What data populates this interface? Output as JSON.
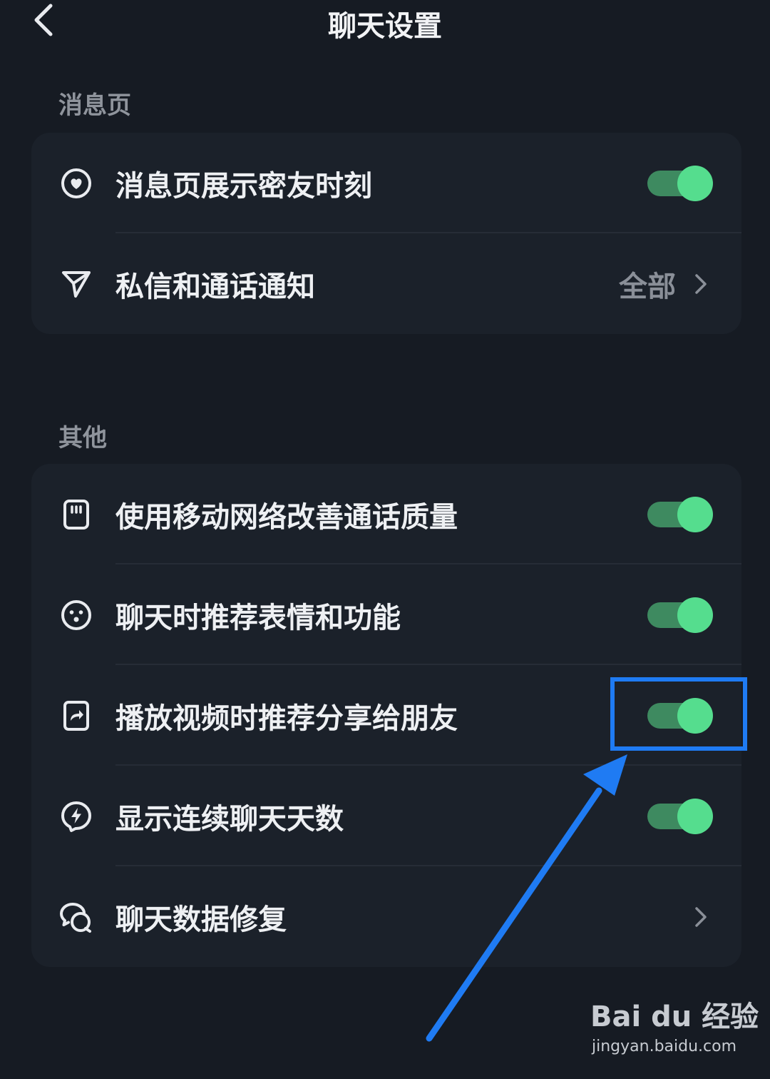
{
  "header": {
    "title": "聊天设置"
  },
  "sections": [
    {
      "title": "消息页",
      "items": [
        {
          "label": "消息页展示密友时刻",
          "control": "toggle",
          "on": true,
          "icon": "heart-circle-icon"
        },
        {
          "label": "私信和通话通知",
          "control": "value",
          "value": "全部",
          "icon": "send-icon"
        }
      ]
    },
    {
      "title": "其他",
      "items": [
        {
          "label": "使用移动网络改善通话质量",
          "control": "toggle",
          "on": true,
          "icon": "sim-card-icon"
        },
        {
          "label": "聊天时推荐表情和功能",
          "control": "toggle",
          "on": true,
          "icon": "smiley-icon"
        },
        {
          "label": "播放视频时推荐分享给朋友",
          "control": "toggle",
          "on": true,
          "icon": "share-icon"
        },
        {
          "label": "显示连续聊天天数",
          "control": "toggle",
          "on": true,
          "icon": "lightning-icon"
        },
        {
          "label": "聊天数据修复",
          "control": "chevron",
          "icon": "chat-bubbles-icon"
        }
      ]
    }
  ],
  "colors": {
    "background": "#161b23",
    "card": "#1b212a",
    "toggle_on_knob": "#55dd8e",
    "toggle_on_track": "#3e8a60",
    "annotation": "#1f7bf3"
  },
  "watermark": {
    "brand": "Bai du 经验",
    "url": "jingyan.baidu.com"
  }
}
